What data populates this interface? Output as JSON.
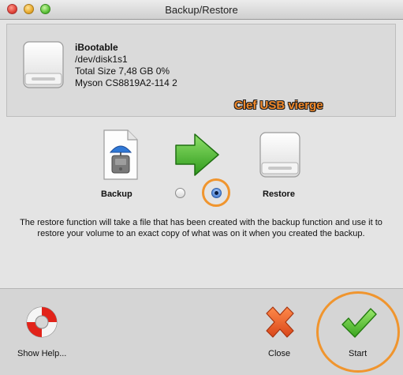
{
  "window": {
    "title": "Backup/Restore"
  },
  "device": {
    "name": "iBootable",
    "path": "/dev/disk1s1",
    "size": "Total Size 7,48 GB 0%",
    "model": "Myson CS8819A2-114 2"
  },
  "annotation": {
    "label": "Clef USB vierge",
    "color": "#f0882a",
    "ring_color": "#f0952e"
  },
  "mode": {
    "backup_label": "Backup",
    "restore_label": "Restore",
    "selected": "restore"
  },
  "description": "The restore function will take a file that has been created with the backup function and use it to restore your volume to an exact copy of what was on it when you created the backup.",
  "buttons": {
    "help_label": "Show Help...",
    "close_label": "Close",
    "start_label": "Start"
  },
  "icons": [
    "hard-drive-icon",
    "backup-file-icon",
    "green-arrow-icon",
    "lifebuoy-icon",
    "red-x-icon",
    "green-check-icon"
  ],
  "colors": {
    "accent": "#f0882a",
    "radio_selected": "#2c5ab0",
    "arrow": "#3fae2a",
    "check": "#4fbf2c",
    "close_x": "#e05a1c"
  }
}
